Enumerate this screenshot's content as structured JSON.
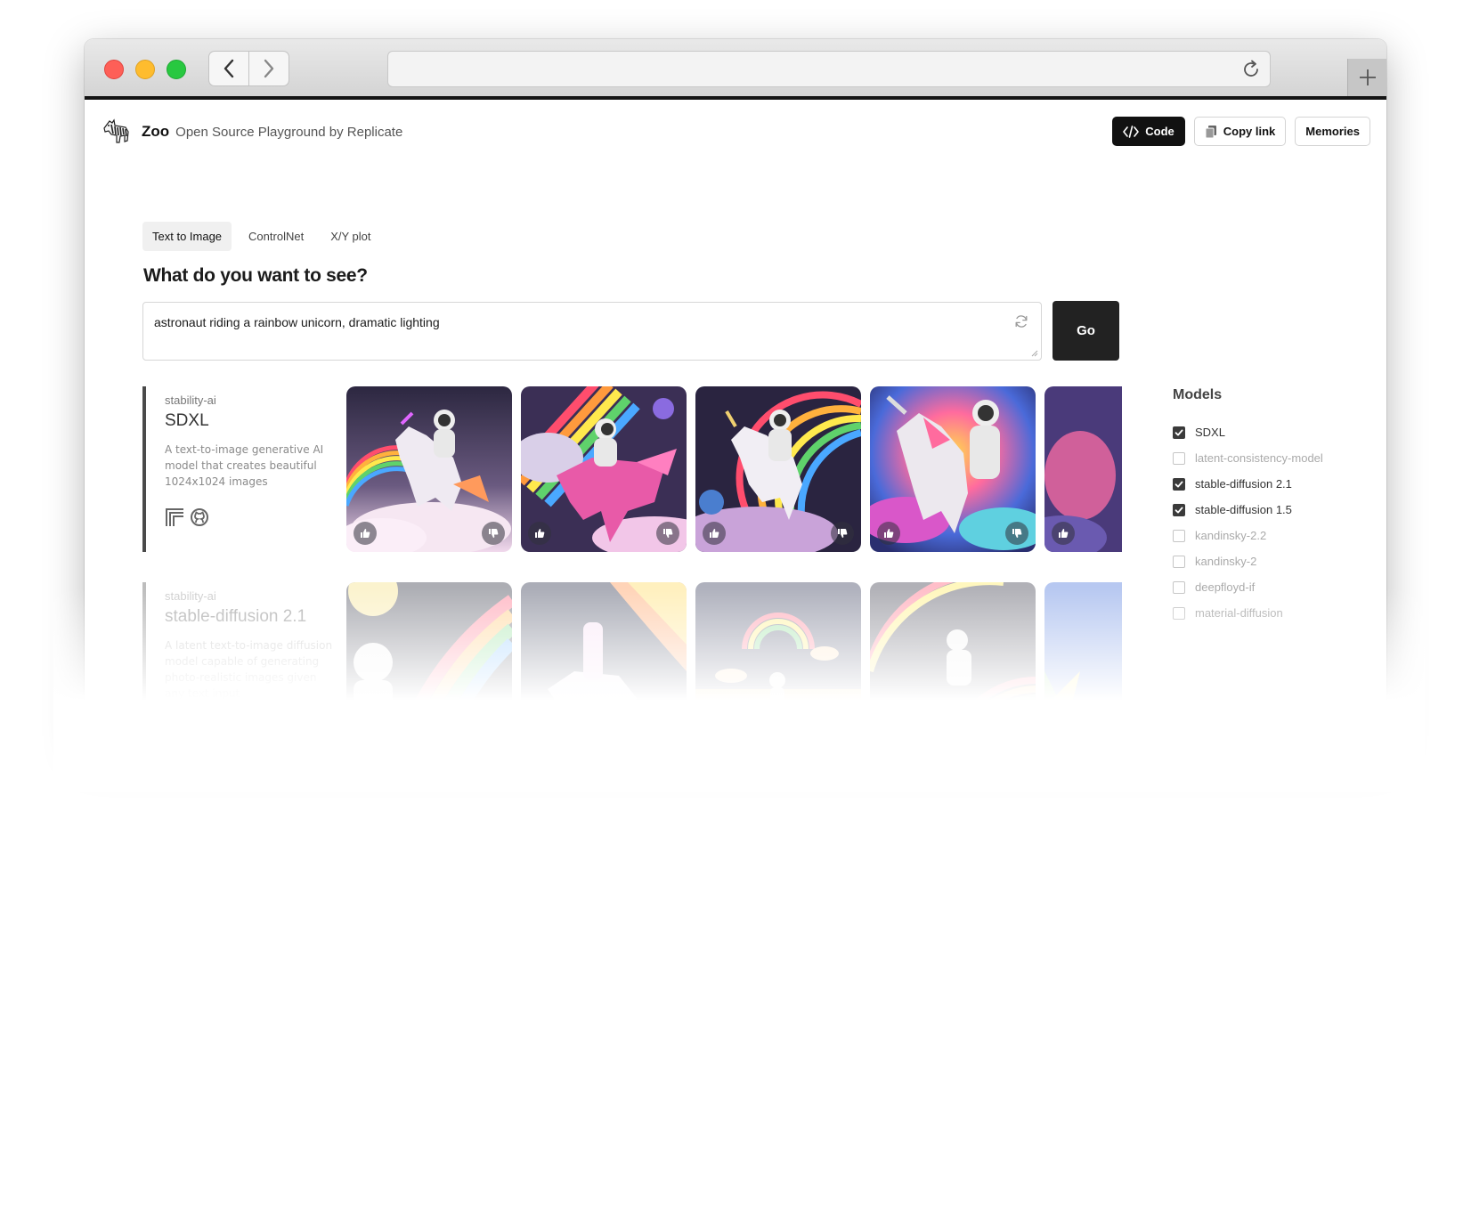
{
  "app": {
    "name": "Zoo",
    "subtitle": "Open Source Playground by Replicate"
  },
  "header": {
    "code_label": "Code",
    "copy_link_label": "Copy link",
    "memories_label": "Memories"
  },
  "tabs": [
    {
      "label": "Text to Image",
      "active": true
    },
    {
      "label": "ControlNet",
      "active": false
    },
    {
      "label": "X/Y plot",
      "active": false
    }
  ],
  "question": "What do you want to see?",
  "prompt": {
    "value": "astronaut riding a rainbow unicorn, dramatic lighting"
  },
  "go_label": "Go",
  "rows": [
    {
      "owner": "stability-ai",
      "name": "SDXL",
      "description": "A text-to-image generative AI model that creates beautiful 1024x1024 images"
    },
    {
      "owner": "stability-ai",
      "name": "stable-diffusion 2.1",
      "description": "A latent text-to-image diffusion model capable of generating photo-realistic images given any text input"
    }
  ],
  "sidebar": {
    "title": "Models",
    "models": [
      {
        "label": "SDXL",
        "checked": true
      },
      {
        "label": "latent-consistency-model",
        "checked": false
      },
      {
        "label": "stable-diffusion 2.1",
        "checked": true
      },
      {
        "label": "stable-diffusion 1.5",
        "checked": true
      },
      {
        "label": "kandinsky-2.2",
        "checked": false
      },
      {
        "label": "kandinsky-2",
        "checked": false
      },
      {
        "label": "deepfloyd-if",
        "checked": false
      },
      {
        "label": "material-diffusion",
        "checked": false
      }
    ]
  },
  "icons": {
    "tab_close": "close-traffic-light",
    "back": "chevron-left-icon",
    "forward": "chevron-right-icon",
    "reload": "reload-icon",
    "new_tab": "plus-icon",
    "code": "code-icon",
    "copy": "copy-icon",
    "refresh_prompt": "refresh-icon",
    "replicate": "replicate-icon",
    "github": "github-icon",
    "thumbs_up": "thumbs-up-icon",
    "thumbs_down": "thumbs-down-icon"
  },
  "colors": {
    "accent_dark": "#111111",
    "checkbox_on": "#3a3a3a",
    "traffic_red": "#fe5f57",
    "traffic_yellow": "#febc2e",
    "traffic_green": "#28c840"
  }
}
